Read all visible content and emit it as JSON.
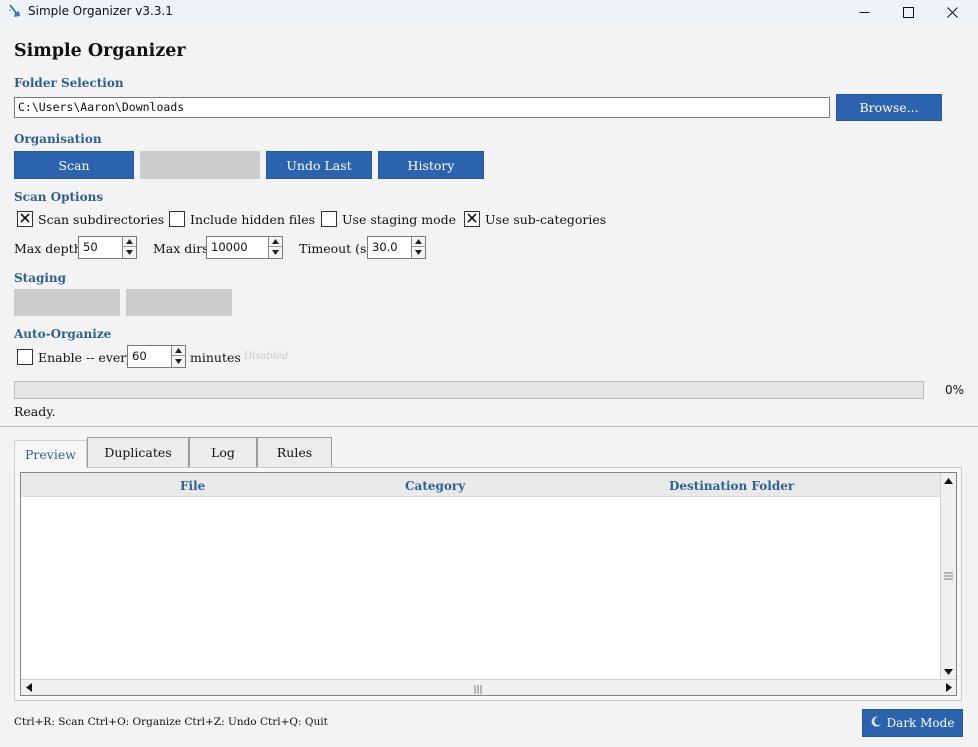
{
  "window": {
    "title": "Simple Organizer  v3.3.1",
    "app_icon": "broom-icon",
    "controls": [
      "minimize-icon",
      "maximize-icon",
      "close-icon"
    ]
  },
  "app_title": "Simple Organizer",
  "folder_selection": {
    "label": "Folder Selection",
    "path_value": "C:\\Users\\Aaron\\Downloads",
    "browse_label": "Browse..."
  },
  "organisation": {
    "label": "Organisation",
    "scan_label": "Scan",
    "organize_label": "",
    "undo_label": "Undo Last",
    "history_label": "History"
  },
  "scan_options": {
    "label": "Scan Options",
    "checkboxes": [
      {
        "label": "Scan subdirectories",
        "checked": true
      },
      {
        "label": "Include hidden files",
        "checked": false
      },
      {
        "label": "Use staging mode",
        "checked": false
      },
      {
        "label": "Use sub-categories",
        "checked": true
      }
    ],
    "max_depth_label": "Max depth:",
    "max_depth_value": "50",
    "max_dirs_label": "Max dirs:",
    "max_dirs_value": "10000",
    "timeout_label": "Timeout (s):",
    "timeout_value": "30.0"
  },
  "staging": {
    "label": "Staging"
  },
  "auto_organize": {
    "label": "Auto-Organize",
    "enable_label": "Enable -- every",
    "enabled": false,
    "interval_value": "60",
    "minutes_label": "minutes",
    "state_text": "Disabled"
  },
  "progress": {
    "percent": 0,
    "percent_text": "0%",
    "status": "Ready."
  },
  "tabs": [
    {
      "label": "Preview",
      "active": true
    },
    {
      "label": "Duplicates",
      "active": false
    },
    {
      "label": "Log",
      "active": false
    },
    {
      "label": "Rules",
      "active": false
    }
  ],
  "preview_table": {
    "columns": [
      "File",
      "Category",
      "Destination Folder"
    ],
    "rows": []
  },
  "footer": {
    "shortcuts": "Ctrl+R: Scan  Ctrl+O: Organize  Ctrl+Z: Undo  Ctrl+Q: Quit",
    "dark_mode_label": "Dark Mode",
    "dark_mode_icon": "moon-icon"
  },
  "colors": {
    "accent": "#2b63ae",
    "section_label": "#2f5f94",
    "disabled_button": "#cccccc",
    "window_bg": "#f3f3f3"
  }
}
